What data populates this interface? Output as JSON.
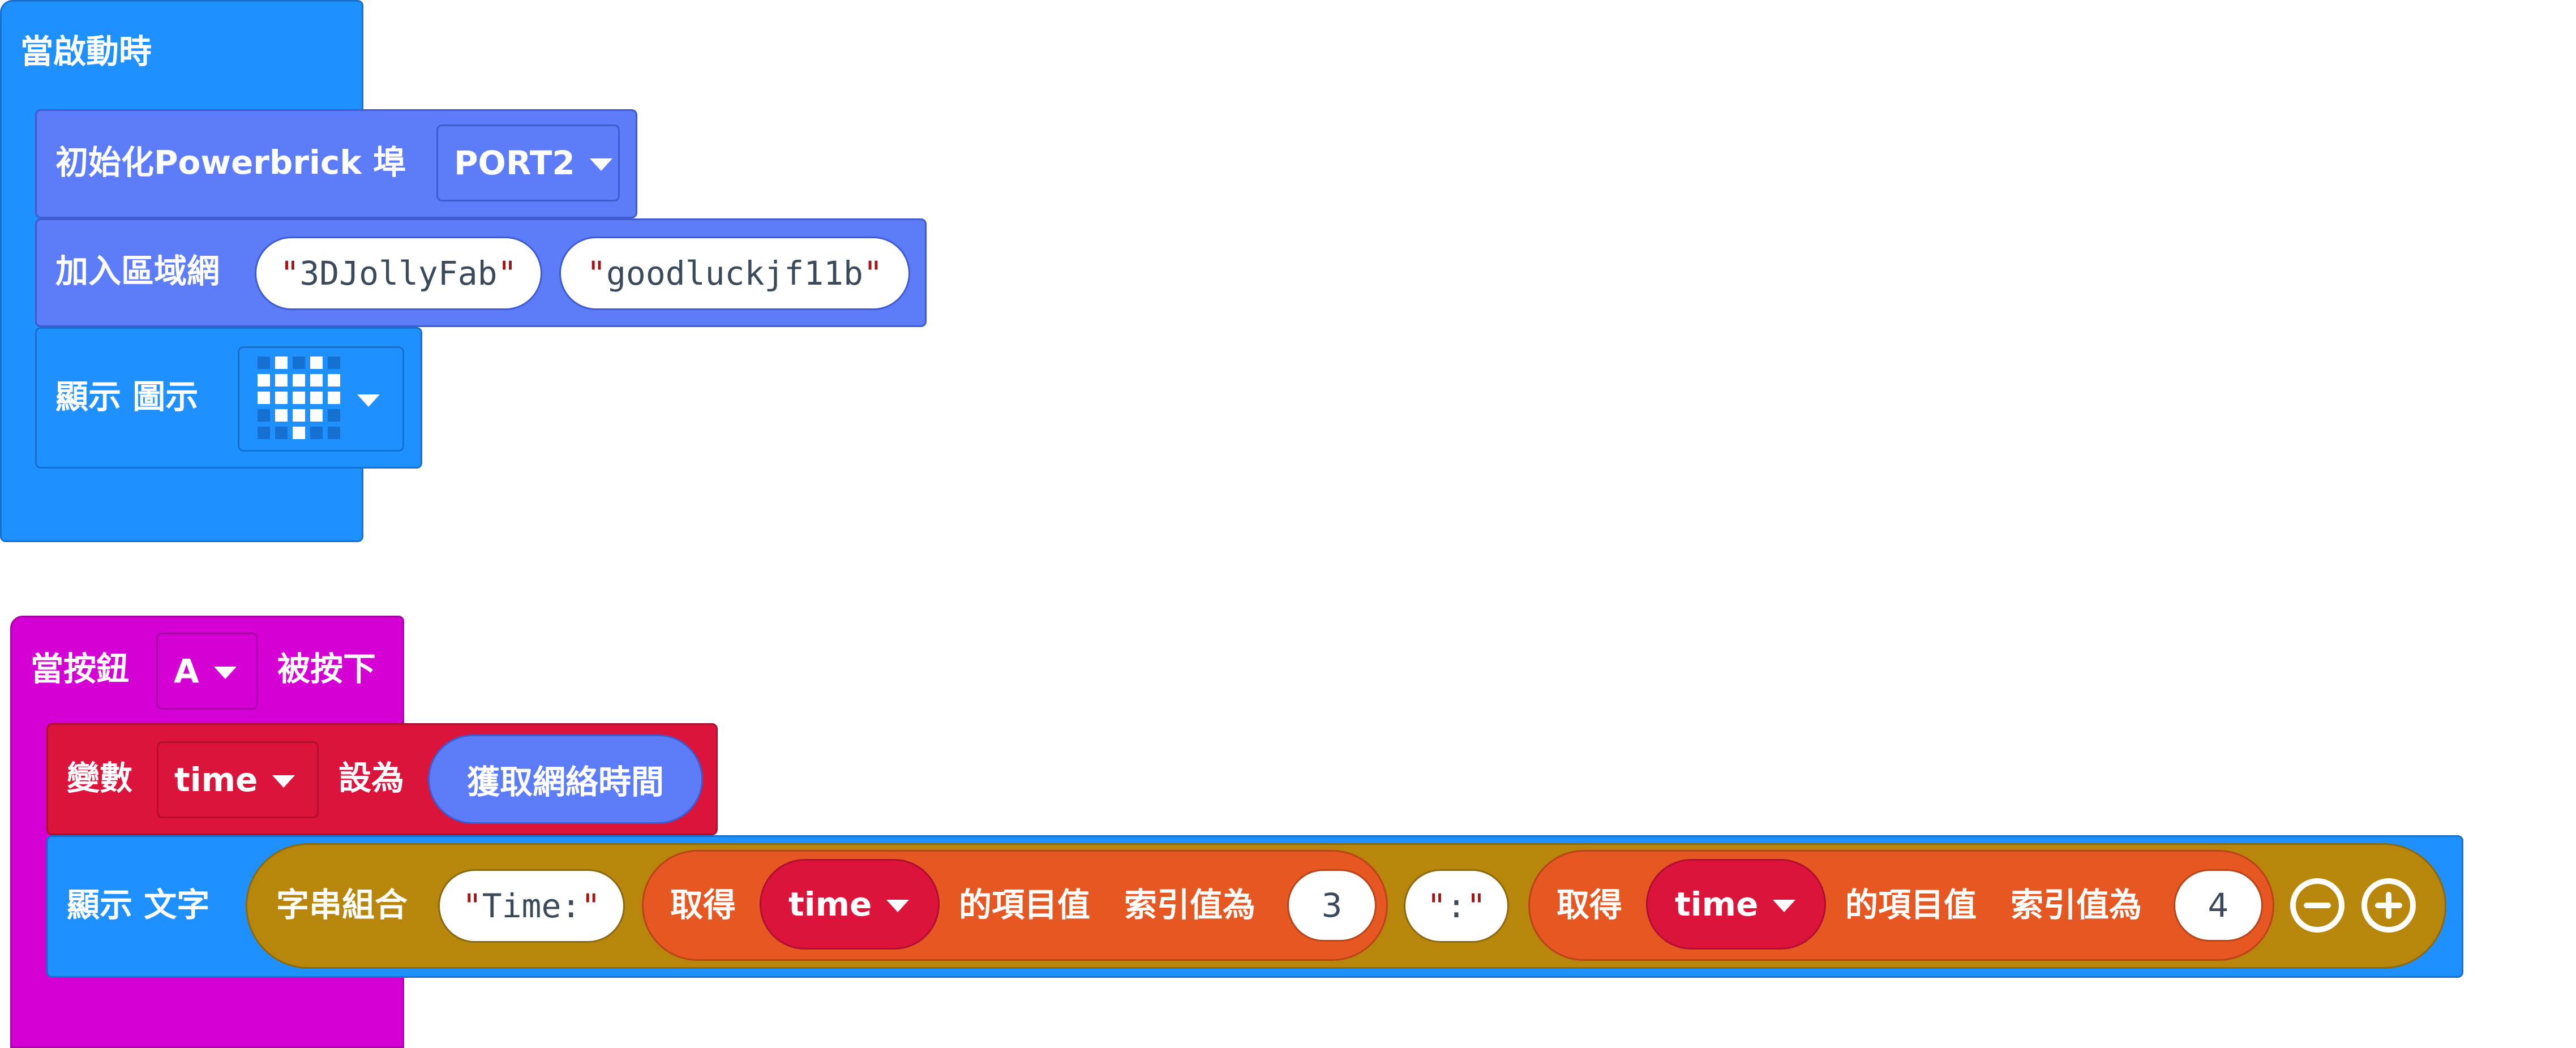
{
  "on_start": {
    "hat_label": "當啟動時",
    "init_label": "初始化Powerbrick 埠",
    "port": "PORT2",
    "wifi_label": "加入區域網",
    "ssid": "3DJollyFab",
    "password": "goodluckjf11b",
    "show_icon_label": "顯示 圖示",
    "icon": "heart-icon"
  },
  "on_button": {
    "label_when": "當按鈕",
    "button": "A",
    "label_pressed": "被按下",
    "set_label": "變數",
    "variable": "time",
    "set_to_label": "設為",
    "get_time_label": "獲取網絡時間",
    "show_text_label": "顯示 文字",
    "join_label": "字串組合",
    "join_items": {
      "time_text": "Time:",
      "get_label_1": "取得",
      "var_1": "time",
      "item_value_label_1": "的項目值",
      "index_label_1": "索引值為",
      "index_1": "3",
      "colon_text": ":",
      "get_label_2": "取得",
      "var_2": "time",
      "item_value_label_2": "的項目值",
      "index_label_2": "索引值為",
      "index_2": "4"
    }
  },
  "colors": {
    "basic_blue": "#1e90ff",
    "powerbrick": "#5c7cfa",
    "input_magenta": "#d400d4",
    "variables_red": "#dc143c",
    "text_gold": "#b8860b",
    "array_orange": "#e65722"
  }
}
